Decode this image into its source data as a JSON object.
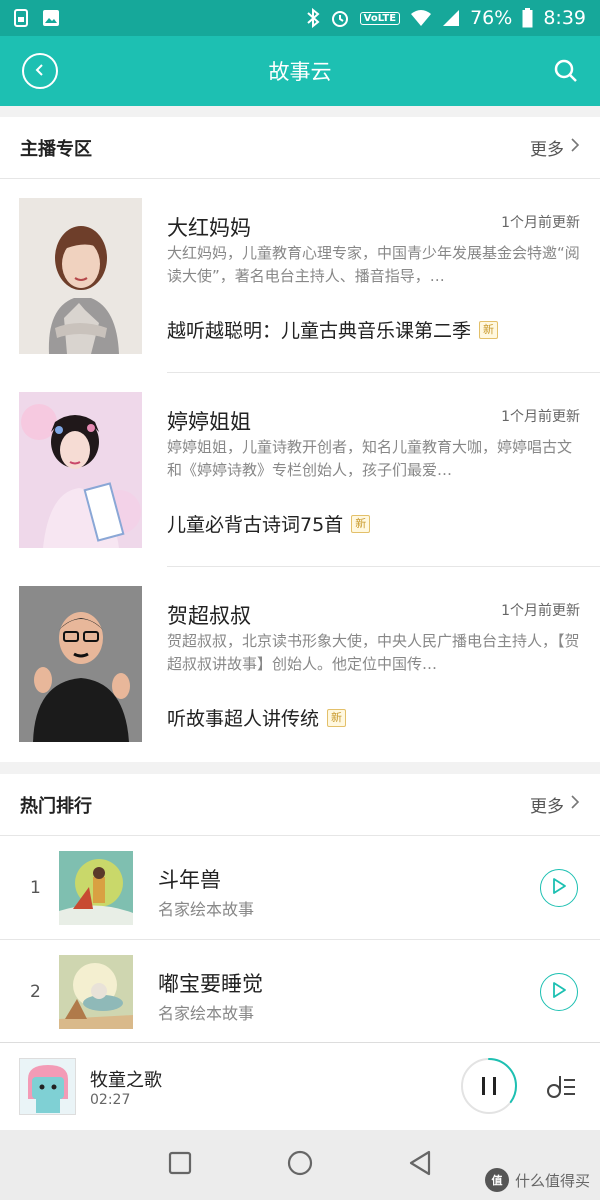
{
  "status_bar": {
    "battery": "76%",
    "time": "8:39",
    "network_badge": "VoLTE"
  },
  "header": {
    "title": "故事云"
  },
  "anchors_section": {
    "title": "主播专区",
    "more_label": "更多",
    "items": [
      {
        "name": "大红妈妈",
        "updated": "1个月前更新",
        "description": "大红妈妈，儿童教育心理专家，中国青少年发展基金会特邀“阅读大使”，著名电台主持人、播音指导，…",
        "album": "越听越聪明：儿童古典音乐课第二季",
        "badge": "新"
      },
      {
        "name": "婷婷姐姐",
        "updated": "1个月前更新",
        "description": "婷婷姐姐，儿童诗教开创者，知名儿童教育大咖，婷婷唱古文和《婷婷诗教》专栏创始人，孩子们最爱…",
        "album": "儿童必背古诗词75首",
        "badge": "新"
      },
      {
        "name": "贺超叔叔",
        "updated": "1个月前更新",
        "description": "贺超叔叔，北京读书形象大使，中央人民广播电台主持人，【贺超叔叔讲故事】创始人。他定位中国传…",
        "album": "听故事超人讲传统",
        "badge": "新"
      }
    ]
  },
  "ranking_section": {
    "title": "热门排行",
    "more_label": "更多",
    "items": [
      {
        "rank": "1",
        "title": "斗年兽",
        "subtitle": "名家绘本故事"
      },
      {
        "rank": "2",
        "title": "嘟宝要睡觉",
        "subtitle": "名家绘本故事"
      }
    ]
  },
  "player": {
    "title": "牧童之歌",
    "time": "02:27",
    "progress": 0.35
  },
  "watermark": {
    "logo": "值",
    "text": "什么值得买"
  },
  "colors": {
    "header": "#1dc0b2",
    "status_bar": "#16a89a",
    "accent": "#1dc0b2",
    "badge": "#c99a2e"
  }
}
